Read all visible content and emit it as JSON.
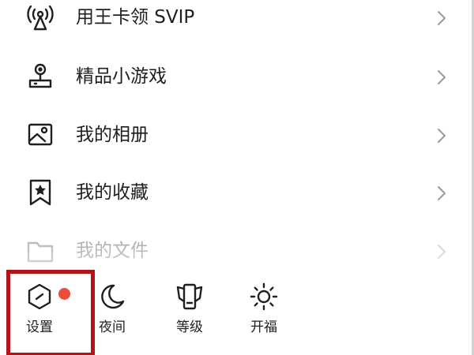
{
  "menu": {
    "items": [
      {
        "label": "用王卡领 SVIP",
        "icon": "signal-tower-icon"
      },
      {
        "label": "精品小游戏",
        "icon": "joystick-icon"
      },
      {
        "label": "我的相册",
        "icon": "photo-album-icon"
      },
      {
        "label": "我的收藏",
        "icon": "bookmark-star-icon"
      },
      {
        "label": "我的文件",
        "icon": "folder-icon"
      }
    ]
  },
  "bottom_bar": {
    "settings_label": "设置",
    "night_label": "夜间",
    "level_label": "等级",
    "fortune_label": "开福"
  },
  "colors": {
    "badge": "#ee4b3b",
    "highlight_box": "#b3141a",
    "text": "#1f1f1f",
    "faded_text": "#9a9a9a"
  }
}
